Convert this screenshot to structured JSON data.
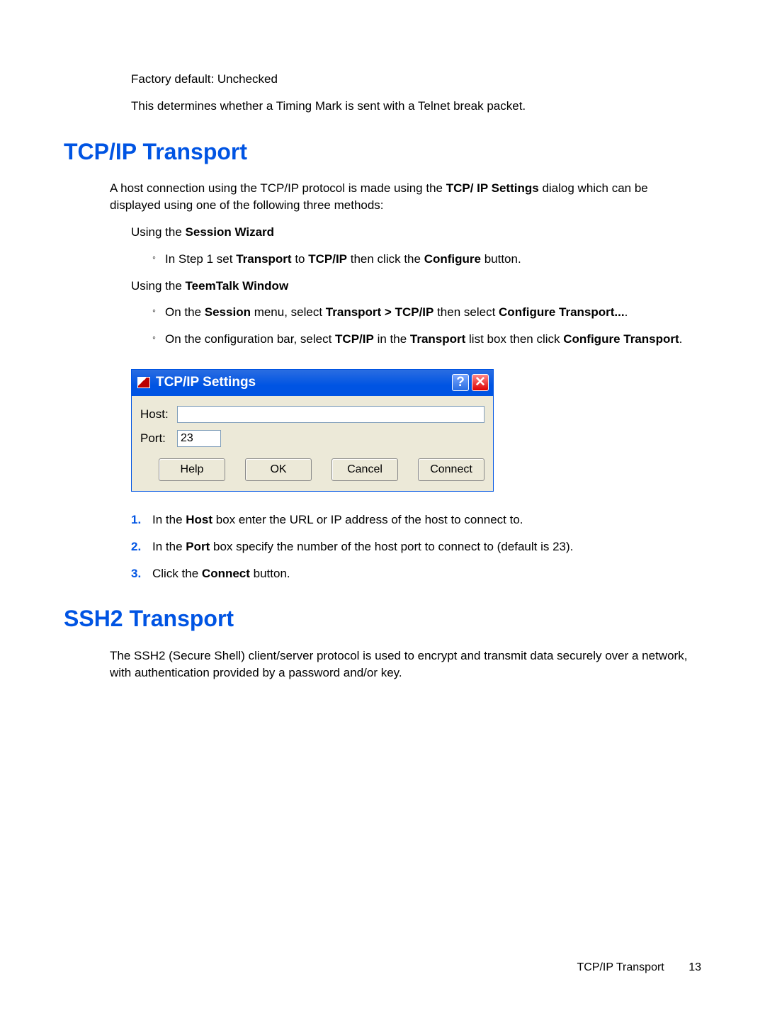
{
  "prelude": {
    "factory_default": "Factory default: Unchecked",
    "desc": "This determines whether a Timing Mark is sent with a Telnet break packet."
  },
  "tcpip": {
    "heading": "TCP/IP Transport",
    "intro_pre": "A host connection using the TCP/IP protocol is made using the ",
    "intro_bold": "TCP/ IP Settings",
    "intro_post": " dialog which can be displayed using one of the following three methods:",
    "using_sw_pre": "Using the ",
    "using_sw_bold": "Session Wizard",
    "sw_item_pre": "In Step 1 set ",
    "sw_item_b1": "Transport",
    "sw_item_mid": " to ",
    "sw_item_b2": "TCP/IP",
    "sw_item_mid2": " then click the ",
    "sw_item_b3": "Configure",
    "sw_item_post": " button.",
    "using_tt_pre": "Using the ",
    "using_tt_bold": "TeemTalk Window",
    "tt_item1_pre": "On the ",
    "tt_item1_b1": "Session",
    "tt_item1_mid": " menu, select ",
    "tt_item1_b2": "Transport > TCP/IP",
    "tt_item1_mid2": " then select ",
    "tt_item1_b3": "Configure Transport...",
    "tt_item1_post": ".",
    "tt_item2_pre": "On the configuration bar, select ",
    "tt_item2_b1": "TCP/IP",
    "tt_item2_mid": " in the ",
    "tt_item2_b2": "Transport",
    "tt_item2_mid2": " list box then click ",
    "tt_item2_b3": "Configure Transport",
    "tt_item2_post": "."
  },
  "dialog": {
    "title": "TCP/IP Settings",
    "host_label": "Host:",
    "host_value": "",
    "port_label": "Port:",
    "port_value": "23",
    "buttons": {
      "help": "Help",
      "ok": "OK",
      "cancel": "Cancel",
      "connect": "Connect"
    }
  },
  "steps": {
    "n1": "1.",
    "s1_pre": "In the ",
    "s1_b": "Host",
    "s1_post": " box enter the URL or IP address of the host to connect to.",
    "n2": "2.",
    "s2_pre": "In the ",
    "s2_b": "Port",
    "s2_post": " box specify the number of the host port to connect to (default is 23).",
    "n3": "3.",
    "s3_pre": "Click the ",
    "s3_b": "Connect",
    "s3_post": " button."
  },
  "ssh2": {
    "heading": "SSH2 Transport",
    "intro": "The SSH2 (Secure Shell) client/server protocol is used to encrypt and transmit data securely over a network, with authentication provided by a password and/or key."
  },
  "footer": {
    "label": "TCP/IP Transport",
    "page": "13"
  }
}
